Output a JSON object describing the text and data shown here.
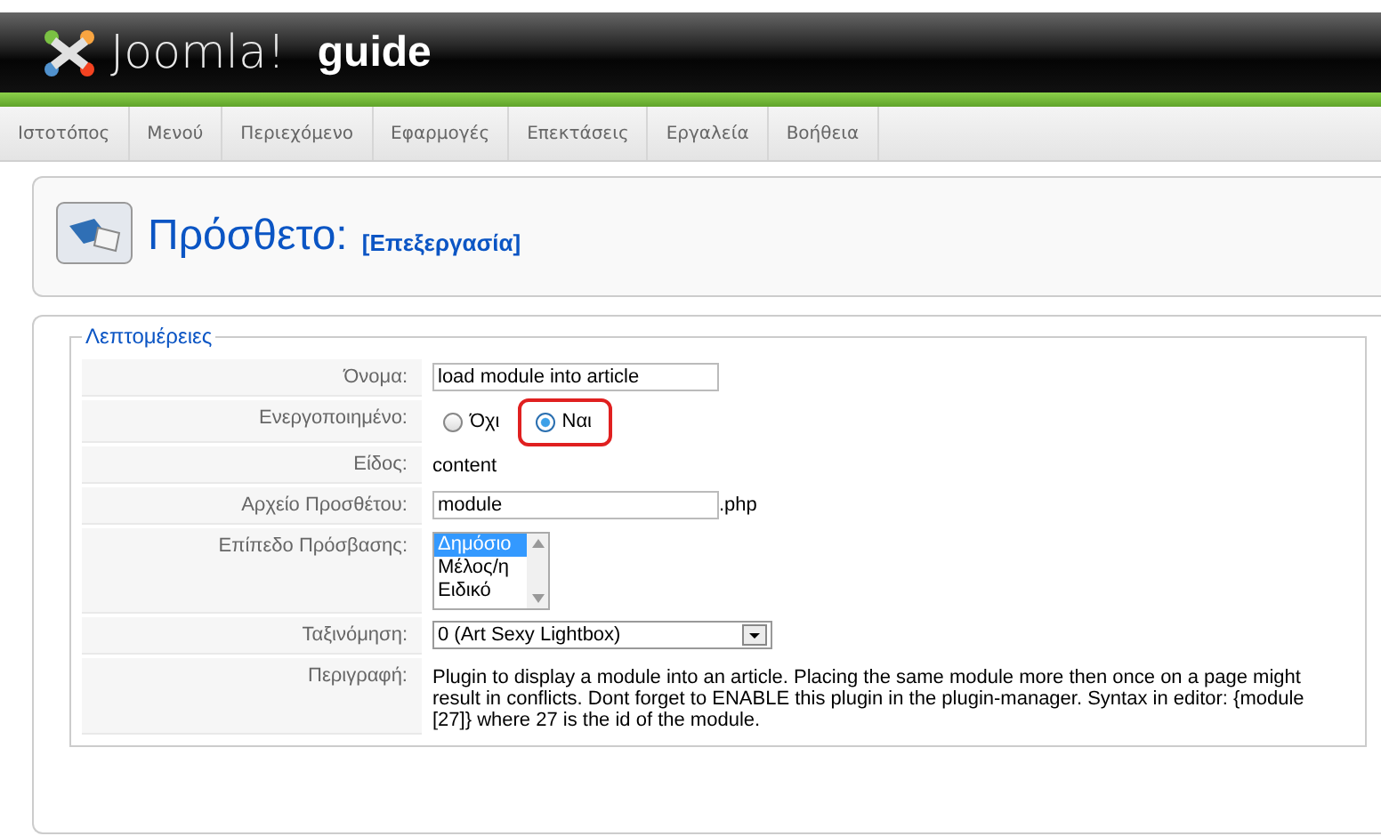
{
  "header": {
    "logo_text": "Joomla!",
    "site_name": "guide"
  },
  "menu": [
    "Ιστοτόπος",
    "Μενού",
    "Περιεχόμενο",
    "Εφαρμογές",
    "Επεκτάσεις",
    "Εργαλεία",
    "Βοήθεια"
  ],
  "page_title": {
    "title": "Πρόσθετο:",
    "subtitle": "[Επεξεργασία]"
  },
  "details": {
    "legend": "Λεπτομέρειες",
    "rows": [
      {
        "kind": "text",
        "label": "Όνομα:",
        "value": "load module into article"
      },
      {
        "kind": "radio",
        "label": "Ενεργοποιημένο:",
        "options": [
          {
            "label": "Όχι",
            "selected": false
          },
          {
            "label": "Ναι",
            "selected": true
          }
        ]
      },
      {
        "kind": "static",
        "label": "Είδος:",
        "value": "content"
      },
      {
        "kind": "text",
        "label": "Αρχείο Προσθέτου:",
        "value": "module",
        "suffix": ".php"
      },
      {
        "kind": "listbox",
        "label": "Επίπεδο Πρόσβασης:",
        "options": [
          {
            "label": "Δημόσιο",
            "selected": true
          },
          {
            "label": "Μέλος/η",
            "selected": false
          },
          {
            "label": "Ειδικό",
            "selected": false
          }
        ]
      },
      {
        "kind": "select",
        "label": "Ταξινόμηση:",
        "value": "0 (Art Sexy Lightbox)"
      },
      {
        "kind": "static",
        "label": "Περιγραφή:",
        "value": "Plugin to display a module into an article. Placing the same module more then once on a page might result in conflicts. Dont forget to ENABLE this plugin in the plugin-manager. Syntax in editor: {module [27]} where 27 is the id of the module."
      }
    ]
  }
}
